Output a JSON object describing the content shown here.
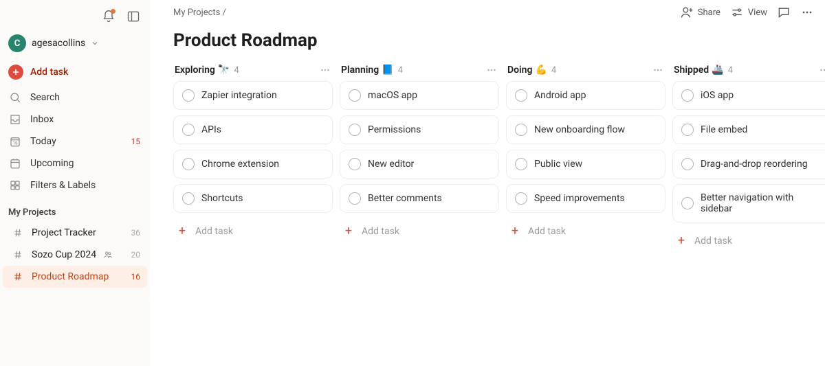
{
  "sidebar": {
    "workspace": {
      "initial": "C",
      "name": "agesacollins"
    },
    "addTask": "Add task",
    "nav": [
      {
        "id": "search",
        "label": "Search",
        "count": ""
      },
      {
        "id": "inbox",
        "label": "Inbox",
        "count": ""
      },
      {
        "id": "today",
        "label": "Today",
        "count": "15"
      },
      {
        "id": "upcoming",
        "label": "Upcoming",
        "count": ""
      },
      {
        "id": "filters",
        "label": "Filters & Labels",
        "count": ""
      }
    ],
    "projectsTitle": "My Projects",
    "projects": [
      {
        "label": "Project Tracker",
        "count": "36",
        "collab": false,
        "active": false
      },
      {
        "label": "Sozo Cup 2024",
        "count": "20",
        "collab": true,
        "active": false
      },
      {
        "label": "Product Roadmap",
        "count": "16",
        "collab": false,
        "active": true
      }
    ]
  },
  "header": {
    "breadcrumbs": "My Projects /",
    "share": "Share",
    "view": "View"
  },
  "page": {
    "title": "Product Roadmap"
  },
  "board": {
    "addTaskLabel": "Add task",
    "columns": [
      {
        "title": "Exploring",
        "emoji": "🔭",
        "count": 4,
        "cards": [
          "Zapier integration",
          "APIs",
          "Chrome extension",
          "Shortcuts"
        ]
      },
      {
        "title": "Planning",
        "emoji": "📘",
        "count": 4,
        "cards": [
          "macOS app",
          "Permissions",
          "New editor",
          "Better comments"
        ]
      },
      {
        "title": "Doing",
        "emoji": "💪",
        "count": 4,
        "cards": [
          "Android app",
          "New onboarding flow",
          "Public view",
          "Speed improvements"
        ]
      },
      {
        "title": "Shipped",
        "emoji": "🚢",
        "count": 4,
        "cards": [
          "iOS app",
          "File embed",
          "Drag-and-drop reordering",
          "Better navigation with sidebar"
        ]
      }
    ]
  }
}
